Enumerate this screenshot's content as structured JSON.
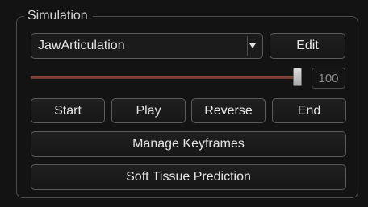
{
  "group": {
    "title": "Simulation"
  },
  "simulation": {
    "selected": "JawArticulation",
    "edit_label": "Edit"
  },
  "slider": {
    "value": 100,
    "max": 100,
    "value_text": "100"
  },
  "playback": {
    "start_label": "Start",
    "play_label": "Play",
    "reverse_label": "Reverse",
    "end_label": "End"
  },
  "actions": {
    "manage_keyframes_label": "Manage Keyframes",
    "soft_tissue_label": "Soft Tissue Prediction"
  },
  "icons": {
    "dropdown_arrow": "chevron-down-icon"
  },
  "colors": {
    "background": "#131313",
    "slider_fill": "#8f4c42",
    "slider_track": "#b8aca7"
  }
}
